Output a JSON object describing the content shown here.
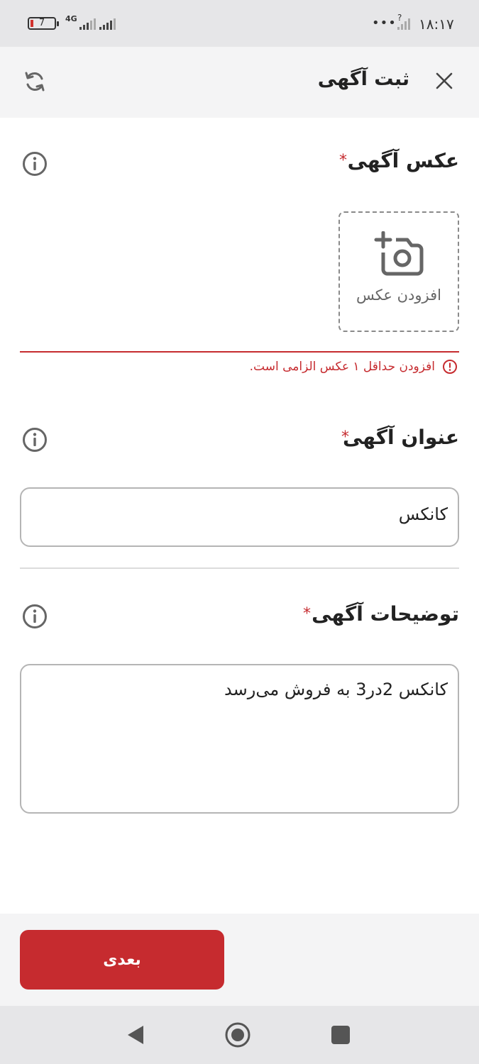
{
  "status_bar": {
    "battery_level": "7",
    "network": "4G",
    "time": "۱۸:۱۷",
    "more_dots": "•••",
    "unknown_signal": "?"
  },
  "header": {
    "title": "ثبت آگهی",
    "close_icon": "close-icon",
    "refresh_icon": "refresh-icon"
  },
  "photo_section": {
    "title": "عکس آگهی",
    "required_mark": "*",
    "add_photo_label": "افزودن عکس",
    "error_message": "افزودن حداقل ۱ عکس الزامی است."
  },
  "title_section": {
    "title": "عنوان آگهی",
    "required_mark": "*",
    "value": "کانکس"
  },
  "description_section": {
    "title": "توضیحات آگهی",
    "required_mark": "*",
    "value": "کانکس 2در3 به فروش می‌رسد"
  },
  "footer": {
    "next_label": "بعدی"
  },
  "colors": {
    "accent": "#c62b2f",
    "header_bg": "#f4f4f5",
    "status_bg": "#e6e6e8"
  }
}
